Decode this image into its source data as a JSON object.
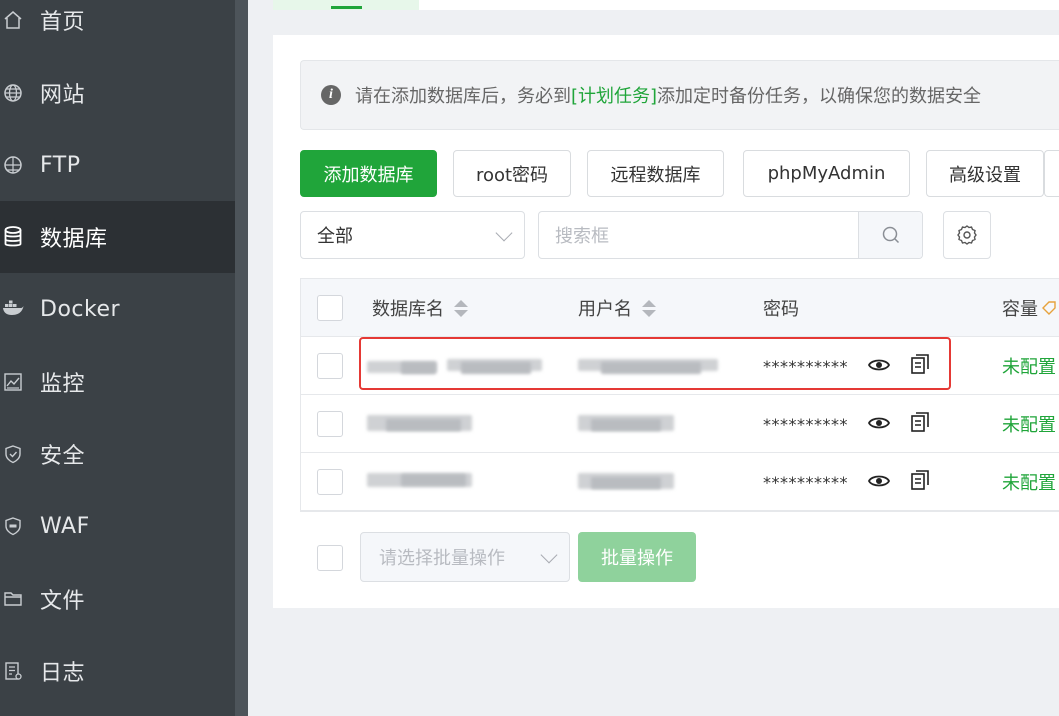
{
  "sidebar": {
    "items": [
      {
        "label": "首页",
        "icon": "home-icon"
      },
      {
        "label": "网站",
        "icon": "globe-icon"
      },
      {
        "label": "FTP",
        "icon": "ftp-globe-icon"
      },
      {
        "label": "数据库",
        "icon": "database-icon",
        "active": true
      },
      {
        "label": "Docker",
        "icon": "docker-icon"
      },
      {
        "label": "监控",
        "icon": "monitor-chart-icon"
      },
      {
        "label": "安全",
        "icon": "shield-icon"
      },
      {
        "label": "WAF",
        "icon": "waf-shield-icon"
      },
      {
        "label": "文件",
        "icon": "folder-icon"
      },
      {
        "label": "日志",
        "icon": "log-icon"
      }
    ]
  },
  "notice": {
    "before": "请在添加数据库后，务必到",
    "link": "[计划任务]",
    "after": "添加定时备份任务，以确保您的数据安全"
  },
  "toolbar": {
    "add_db": "添加数据库",
    "root_pw": "root密码",
    "remote_db": "远程数据库",
    "phpmyadmin": "phpMyAdmin",
    "advanced": "高级设置"
  },
  "filter": {
    "category": "全部",
    "search_placeholder": "搜索框"
  },
  "table": {
    "headers": {
      "name": "数据库名",
      "user": "用户名",
      "password": "密码",
      "capacity": "容量"
    },
    "rows": [
      {
        "password": "**********",
        "capacity": "未配置",
        "highlighted": true
      },
      {
        "password": "**********",
        "capacity": "未配置"
      },
      {
        "password": "**********",
        "capacity": "未配置"
      }
    ]
  },
  "batch": {
    "select_placeholder": "请选择批量操作",
    "button": "批量操作"
  },
  "colors": {
    "accent": "#20a53a",
    "sidebar_bg": "#3b4146",
    "highlight": "#e53935"
  }
}
